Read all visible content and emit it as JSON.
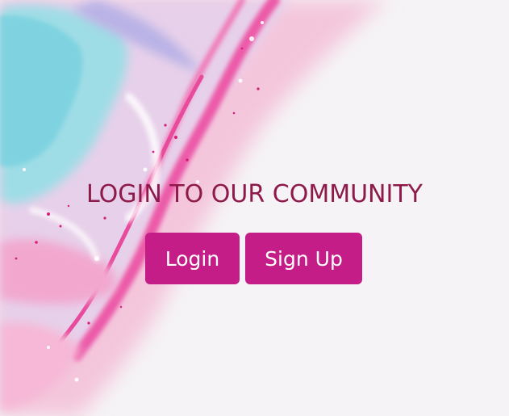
{
  "headline": "LOGIN TO OUR COMMUNITY",
  "buttons": {
    "login_label": "Login",
    "signup_label": "Sign Up"
  },
  "colors": {
    "headline": "#8e1a4b",
    "button_bg": "#c41d87",
    "button_text": "#ffffff",
    "background": "#f5f3f5"
  }
}
